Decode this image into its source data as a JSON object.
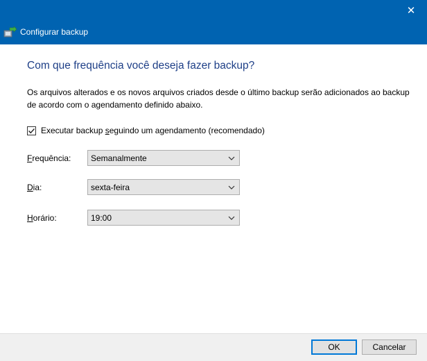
{
  "window": {
    "title": "Configurar backup",
    "close_glyph": "✕"
  },
  "main": {
    "heading": "Com que frequência você deseja fazer backup?",
    "description": "Os arquivos alterados e os novos arquivos criados desde o último backup serão adicionados ao backup de acordo com o agendamento definido abaixo.",
    "schedule_checkbox": {
      "checked": true,
      "label_pre": "Executar backup ",
      "label_u": "s",
      "label_post": "eguindo um agendamento (recomendado)"
    },
    "fields": {
      "frequency": {
        "label_u": "F",
        "label_rest": "requência:",
        "value": "Semanalmente"
      },
      "day": {
        "label_u": "D",
        "label_rest": "ia:",
        "value": "sexta-feira"
      },
      "time": {
        "label_u": "H",
        "label_rest": "orário:",
        "value": "19:00"
      }
    }
  },
  "footer": {
    "ok_label": "OK",
    "cancel_label": "Cancelar"
  },
  "colors": {
    "titlebar": "#0063b1",
    "heading": "#1e3f87",
    "ok_border": "#0078d7"
  },
  "icons": {
    "nav": "backup-icon",
    "close": "close-icon",
    "dropdown": "chevron-down-icon",
    "check": "checkmark-icon"
  }
}
